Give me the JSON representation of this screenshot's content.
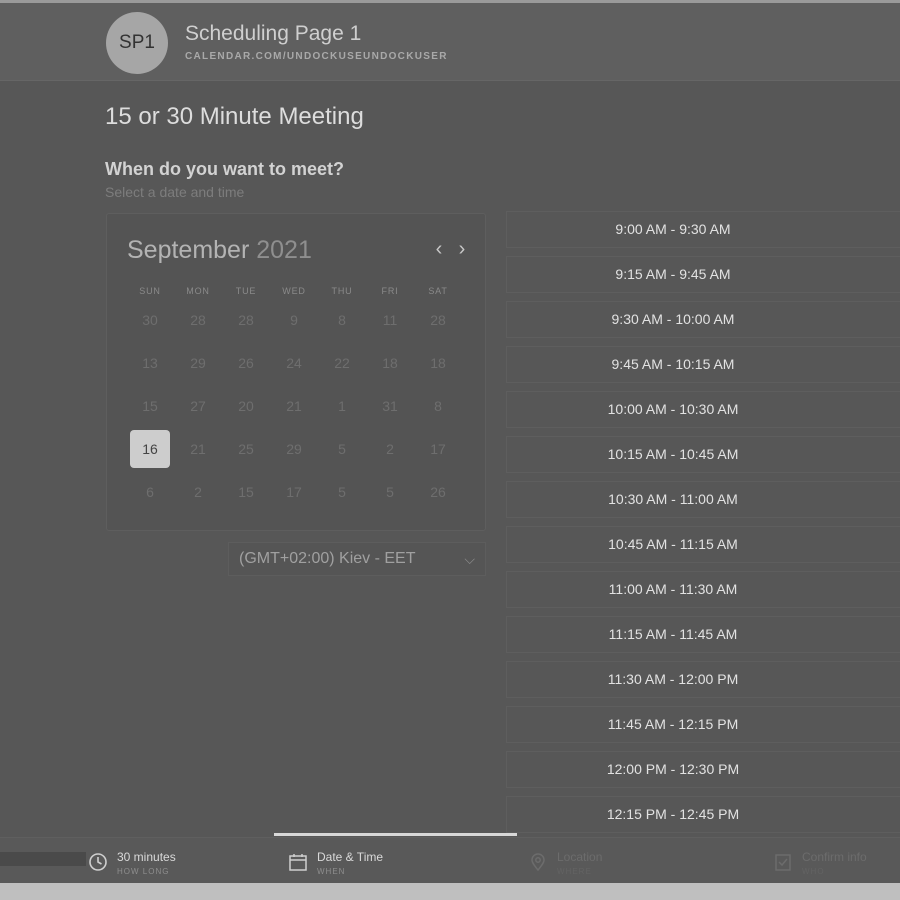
{
  "header": {
    "avatar_initials": "SP1",
    "title": "Scheduling Page 1",
    "url": "CALENDAR.COM/UNDOCKUSEUNDOCKUSER"
  },
  "meeting": {
    "title": "15 or 30 Minute Meeting",
    "question": "When do you want to meet?",
    "question_sub": "Select a date and time"
  },
  "calendar": {
    "month": "September",
    "year": "2021",
    "prev_icon": "chevron-left-icon",
    "next_icon": "chevron-right-icon",
    "weekdays": [
      "SUN",
      "MON",
      "TUE",
      "WED",
      "THU",
      "FRI",
      "SAT"
    ],
    "weeks": [
      [
        "30",
        "28",
        "28",
        "9",
        "8",
        "11",
        "28"
      ],
      [
        "13",
        "29",
        "26",
        "24",
        "22",
        "18",
        "18"
      ],
      [
        "15",
        "27",
        "20",
        "21",
        "1",
        "31",
        "8"
      ],
      [
        "16",
        "21",
        "25",
        "29",
        "5",
        "2",
        "17"
      ],
      [
        "6",
        "2",
        "15",
        "17",
        "5",
        "5",
        "26"
      ]
    ],
    "selected": "16"
  },
  "timezone": {
    "value": "(GMT+02:00) Kiev - EET",
    "icon": "chevron-down-icon"
  },
  "slots": [
    "9:00 AM - 9:30 AM",
    "9:15 AM - 9:45 AM",
    "9:30 AM - 10:00 AM",
    "9:45 AM - 10:15 AM",
    "10:00 AM - 10:30 AM",
    "10:15 AM - 10:45 AM",
    "10:30 AM - 11:00 AM",
    "10:45 AM - 11:15 AM",
    "11:00 AM - 11:30 AM",
    "11:15 AM - 11:45 AM",
    "11:30 AM - 12:00 PM",
    "11:45 AM - 12:15 PM",
    "12:00 PM - 12:30 PM",
    "12:15 PM - 12:45 PM"
  ],
  "steps": [
    {
      "label": "30 minutes",
      "sub": "HOW LONG",
      "icon": "clock-icon"
    },
    {
      "label": "Date & Time",
      "sub": "WHEN",
      "icon": "calendar-icon"
    },
    {
      "label": "Location",
      "sub": "WHERE",
      "icon": "location-pin-icon"
    },
    {
      "label": "Confirm info",
      "sub": "WHO",
      "icon": "checklist-icon"
    }
  ],
  "colors": {
    "background": "#575757",
    "selected_day": "#cdcdcd",
    "text": "#dddddd"
  }
}
